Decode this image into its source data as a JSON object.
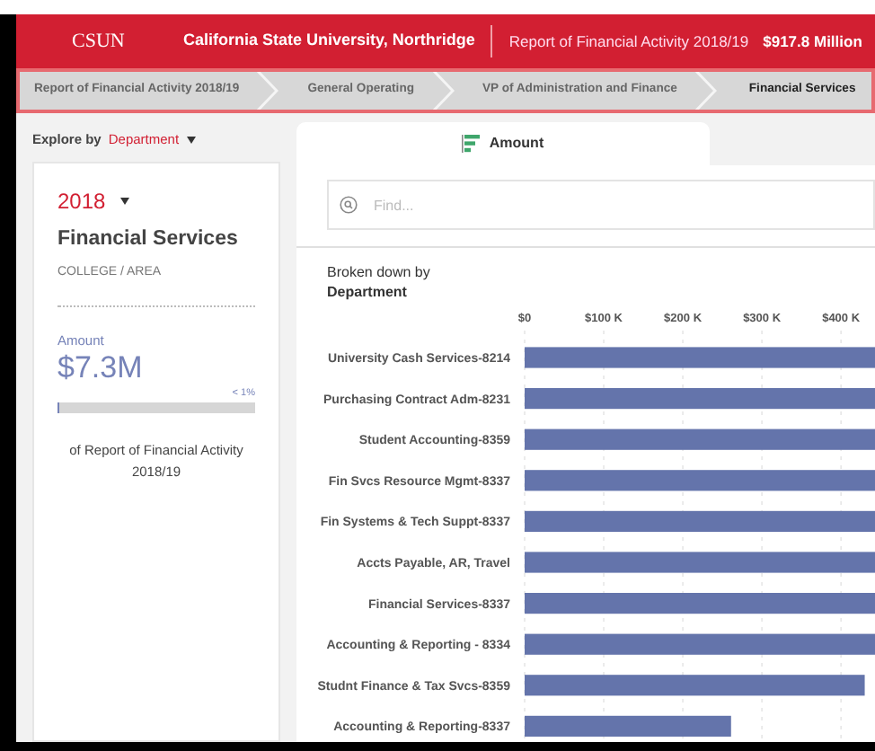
{
  "header": {
    "logo": "CSUN",
    "university": "California State University, Northridge",
    "report": "Report of Financial Activity 2018/19",
    "total": "$917.8 Million"
  },
  "breadcrumbs": [
    {
      "label": "Report of Financial Activity 2018/19",
      "selected": false
    },
    {
      "label": "General Operating",
      "selected": false
    },
    {
      "label": "VP of Administration and Finance",
      "selected": false
    },
    {
      "label": "Financial Services",
      "selected": true
    }
  ],
  "explore": {
    "label": "Explore by",
    "value": "Department"
  },
  "card": {
    "year": "2018",
    "title": "Financial Services",
    "subtitle": "COLLEGE / AREA",
    "metric_label": "Amount",
    "metric_value": "$7.3M",
    "share": "< 1%",
    "level": 0.005,
    "caption": "of Report of Financial Activity 2018/19"
  },
  "tabs": [
    {
      "label": "Amount",
      "selected": true
    }
  ],
  "search": {
    "placeholder": "Find..."
  },
  "breakdown": {
    "label": "Broken down by",
    "value": "Department",
    "chart_data": {
      "type": "bar",
      "orientation": "horizontal",
      "categories": [
        "University Cash Services-8214",
        "Purchasing Contract Adm-8231",
        "Student Accounting-8359",
        "Fin Svcs Resource Mgmt-8337",
        "Fin Systems & Tech Suppt-8337",
        "Accts Payable, AR, Travel",
        "Financial Services-8337",
        "Accounting & Reporting - 8334",
        "Studnt Finance & Tax Svcs-8359",
        "Accounting & Reporting-8337"
      ],
      "series": [
        {
          "color": "#6474ab",
          "values": [
            443,
            443,
            443,
            443,
            443,
            443,
            443,
            443,
            430,
            261
          ]
        }
      ],
      "grid": true,
      "xlim": [
        0,
        443
      ],
      "xticks": [
        {
          "value": 0,
          "label": "$0"
        },
        {
          "value": 100,
          "label": "$100 K"
        },
        {
          "value": 200,
          "label": "$200 K"
        },
        {
          "value": 300,
          "label": "$300 K"
        },
        {
          "value": 400,
          "label": "$400 K"
        }
      ]
    }
  }
}
